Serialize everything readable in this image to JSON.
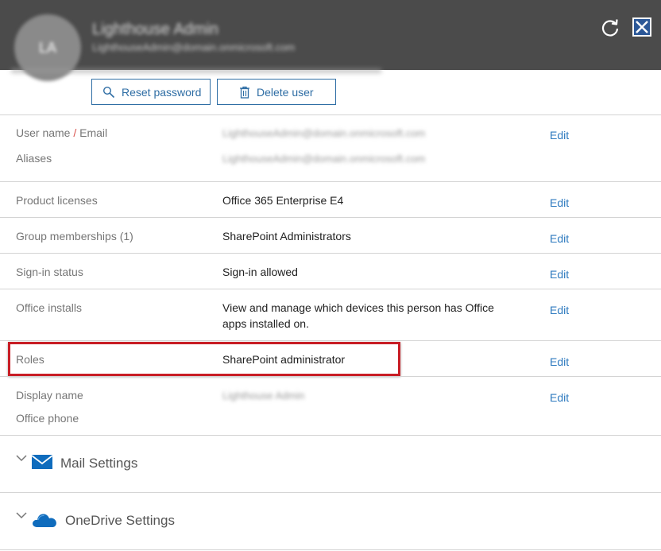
{
  "header": {
    "avatar_initials": "LA",
    "user_display_name": "Lighthouse Admin",
    "user_email": "LighthouseAdmin@domain.onmicrosoft.com"
  },
  "actions": {
    "reset_password": "Reset password",
    "delete_user": "Delete user"
  },
  "details": {
    "username_label": "User name",
    "username_sep": "/",
    "email_label": "Email",
    "username_value": "LighthouseAdmin@domain.onmicrosoft.com",
    "aliases_label": "Aliases",
    "aliases_value": "LighthouseAdmin@domain.onmicrosoft.com",
    "licenses_label": "Product licenses",
    "licenses_value": "Office 365 Enterprise E4",
    "groups_label": "Group memberships (1)",
    "groups_value": "SharePoint Administrators",
    "signin_label": "Sign-in status",
    "signin_value": "Sign-in allowed",
    "installs_label": "Office installs",
    "installs_value": "View and manage which devices this person has Office apps installed on.",
    "roles_label": "Roles",
    "roles_value": "SharePoint administrator",
    "displayname_label": "Display name",
    "displayname_value": "Lighthouse Admin",
    "phone_label": "Office phone",
    "edit_label": "Edit"
  },
  "sections": {
    "mail": "Mail Settings",
    "onedrive": "OneDrive Settings"
  },
  "colors": {
    "header_bg": "#4b4b4b",
    "accent_blue": "#2e6da4",
    "link_blue": "#2e7abf",
    "highlight_red": "#c81d25"
  }
}
